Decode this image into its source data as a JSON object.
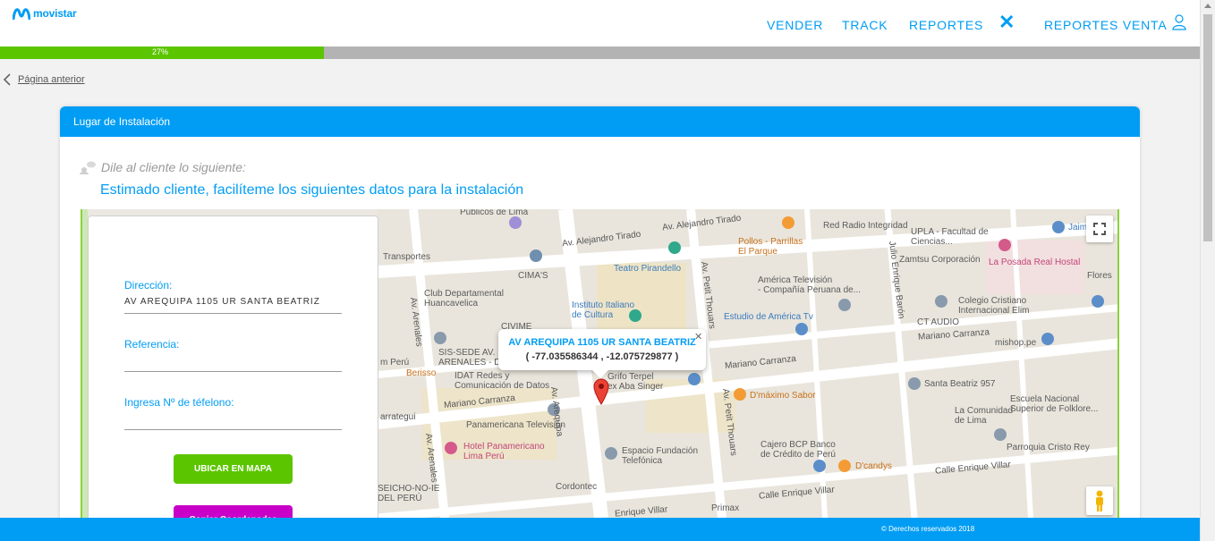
{
  "brand": {
    "name": "movistar",
    "color": "#019df4"
  },
  "nav": {
    "items": [
      "VENDER",
      "TRACK",
      "REPORTES",
      "REPORTES VENTA"
    ],
    "close_icon": "close-x-icon",
    "user_icon": "user-icon"
  },
  "progress": {
    "percent": 27,
    "label": "27%"
  },
  "back_link": {
    "label": "Página anterior"
  },
  "card": {
    "title": "Lugar de Instalación",
    "say_prompt": "Dile al cliente lo siguiente:",
    "script": "Estimado cliente, facilíteme los siguientes datos para la instalación"
  },
  "form": {
    "direccion_label": "Dirección:",
    "direccion_value": "AV AREQUIPA 1105 UR SANTA BEATRIZ",
    "referencia_label": "Referencia:",
    "referencia_value": "",
    "telefono_label": "Ingresa Nº de téfelono:",
    "telefono_value": "",
    "ubicar_button": "UBICAR EN MAPA",
    "copiar_button": "Copiar Coordenadas"
  },
  "map": {
    "info_title": "AV AREQUIPA 1105 UR SANTA BEATRIZ",
    "info_coords": "( -77.035586344 , -12.075729877 )",
    "labels": {
      "publicos": "Públicos de Lima",
      "tirado1": "Av. Alejandro Tirado",
      "tirado2": "Av. Alejandro Tirado",
      "red_radio": "Red Radio Integridad",
      "upla": "UPLA - Facultad de\nCiencias...",
      "jaime": "Jaime",
      "transportes": "Transportes",
      "teatro": "Teatro Pirandello",
      "pollos": "Pollos - Parrillas\nEl Parque",
      "zamtsu": "Zamtsu Corporación",
      "posada": "La Posada Real Hostal",
      "cimas": "CIMA'S",
      "club": "Club Departamental\nHuancavelica",
      "instituto": "Instituto Italiano\nde Cultura",
      "america_tv": "América Televisión\n- Compañía Peruana de...",
      "colegio": "Colegio Cristiano\nInternacional Elim",
      "flores": "Flores",
      "cvime": "CIVIME",
      "estudio": "Estudio de América Tv",
      "ct_audio": "CT AUDIO",
      "mariano1": "Mariano Carranza",
      "sis": "SIS-SEDE AV.\nARENALES - DEL...",
      "mishop": "mishop.pe",
      "peru1": "m Perú",
      "berisso": "Berisso",
      "idat": "IDAT Redes y\nComunicación de Datos",
      "grifo": "Grifo Terpel\nex Aba Singer",
      "mariano2": "Mariano Carranza",
      "dmaximo": "D'máximo Sabor",
      "santa_beatriz": "Santa Beatriz 957",
      "escuela": "Escuela Nacional\nSuperior de Folklore...",
      "comunidad": "La Comunidad\nde Lima",
      "mariano3": "Mariano Carranza",
      "panamericana_tv": "Panamericana Televisión",
      "hotel": "Hotel Panamericano\nLima Perú",
      "fundacion": "Espacio Fundación\nTelefónica",
      "cajero": "Cajero BCP Banco\nde Crédito de Perú",
      "dcandys": "D'candys",
      "parroquia": "Parroquia Cristo Rey",
      "enrique_villar1": "Calle Enrique Villar",
      "enrique_villar2": "Calle Enrique Villar",
      "enrique_villar3": "Enrique Villar",
      "seicho": "SEICHO-NO-IE\nDEL PERÚ",
      "cordontec": "Cordontec",
      "primax": "Primax",
      "arequipa": "Av. Arequipa",
      "arenales1": "Av. Arenales",
      "arenales2": "Av. Arenales",
      "petit1": "Av. Petit Thouars",
      "petit2": "Av. Petit Thouars",
      "baron": "Julio Enrique Barón",
      "arrategui": "arrategui",
      "mariano_left": "Mariano Carranza"
    }
  },
  "footer": {
    "text": "© Derechos reservados 2018"
  }
}
